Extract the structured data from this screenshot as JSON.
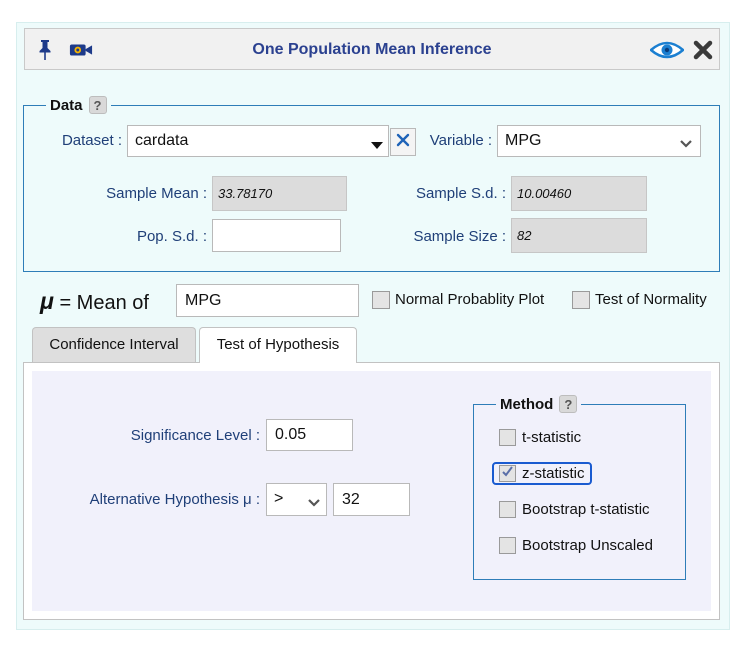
{
  "window": {
    "title": "One Population Mean Inference"
  },
  "data_section": {
    "legend": "Data",
    "help": "?",
    "dataset_label": "Dataset :",
    "dataset_value": "cardata",
    "variable_label": "Variable :",
    "variable_value": "MPG",
    "sample_mean_label": "Sample Mean :",
    "sample_mean_value": "33.78170",
    "sample_sd_label": "Sample S.d. :",
    "sample_sd_value": "10.00460",
    "pop_sd_label": "Pop. S.d. :",
    "pop_sd_value": "",
    "sample_size_label": "Sample Size :",
    "sample_size_value": "82"
  },
  "mean_of": {
    "mu": "μ",
    "label": "= Mean of",
    "value": "MPG",
    "normal_plot_label": "Normal Probablity Plot",
    "normal_plot_checked": false,
    "normality_test_label": "Test of Normality",
    "normality_test_checked": false
  },
  "tabs": [
    {
      "label": "Confidence Interval",
      "active": false
    },
    {
      "label": "Test of Hypothesis",
      "active": true
    }
  ],
  "hypothesis": {
    "significance_label": "Significance Level :",
    "significance_value": "0.05",
    "alternative_label": "Alternative Hypothesis μ :",
    "alternative_operator": ">",
    "alternative_value": "32"
  },
  "method": {
    "legend": "Method",
    "help": "?",
    "options": [
      {
        "label": "t-statistic",
        "checked": false
      },
      {
        "label": "z-statistic",
        "checked": true
      },
      {
        "label": "Bootstrap t-statistic",
        "checked": false
      },
      {
        "label": "Bootstrap Unscaled",
        "checked": false
      }
    ]
  },
  "colors": {
    "accent": "#2e7db8",
    "title": "#2b4190",
    "label": "#1f3f78",
    "panel": "#eefbfb"
  },
  "icons": [
    "pin-icon",
    "camera-icon",
    "eye-icon",
    "close-icon",
    "clear-icon",
    "dropdown-arrow-icon",
    "chevron-down-icon"
  ]
}
